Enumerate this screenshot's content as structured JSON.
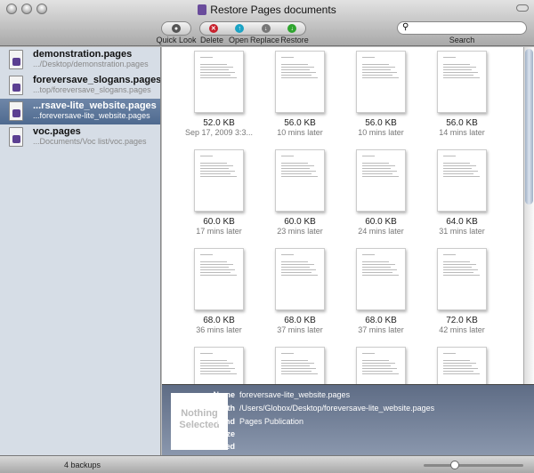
{
  "window": {
    "title": "Restore Pages documents"
  },
  "toolbar": {
    "quick_look": "Quick Look",
    "delete": "Delete",
    "open": "Open",
    "replace": "Replace",
    "restore": "Restore",
    "search_label": "Search",
    "search_value": ""
  },
  "sidebar": [
    {
      "name": "demonstration.pages",
      "path": ".../Desktop/demonstration.pages"
    },
    {
      "name": "foreversave_slogans.pages",
      "path": "...top/foreversave_slogans.pages"
    },
    {
      "name": "...rsave-lite_website.pages",
      "path": "...foreversave-lite_website.pages",
      "selected": true
    },
    {
      "name": "voc.pages",
      "path": "...Documents/Voc list/voc.pages"
    }
  ],
  "versions": [
    {
      "size": "52.0 KB",
      "date": "Sep 17, 2009 3:3..."
    },
    {
      "size": "56.0 KB",
      "date": "10 mins later"
    },
    {
      "size": "56.0 KB",
      "date": "10 mins later"
    },
    {
      "size": "56.0 KB",
      "date": "14 mins later"
    },
    {
      "size": "60.0 KB",
      "date": "17 mins later"
    },
    {
      "size": "60.0 KB",
      "date": "23 mins later"
    },
    {
      "size": "60.0 KB",
      "date": "24 mins later"
    },
    {
      "size": "64.0 KB",
      "date": "31 mins later"
    },
    {
      "size": "68.0 KB",
      "date": "36 mins later"
    },
    {
      "size": "68.0 KB",
      "date": "37 mins later"
    },
    {
      "size": "68.0 KB",
      "date": "37 mins later"
    },
    {
      "size": "72.0 KB",
      "date": "42 mins later"
    },
    {
      "size": "",
      "date": ""
    },
    {
      "size": "",
      "date": ""
    },
    {
      "size": "",
      "date": ""
    },
    {
      "size": "",
      "date": ""
    }
  ],
  "info": {
    "preview": "Nothing Selected",
    "labels": {
      "name": "Name",
      "path": "Path",
      "kind": "Kind",
      "size": "Size",
      "created": "Created"
    },
    "values": {
      "name": "foreversave-lite_website.pages",
      "path": "/Users/Globox/Desktop/foreversave-lite_website.pages",
      "kind": "Pages Publication",
      "size": "",
      "created": ""
    }
  },
  "status": {
    "backups": "4 backups",
    "zoom_fraction": 0.3
  }
}
